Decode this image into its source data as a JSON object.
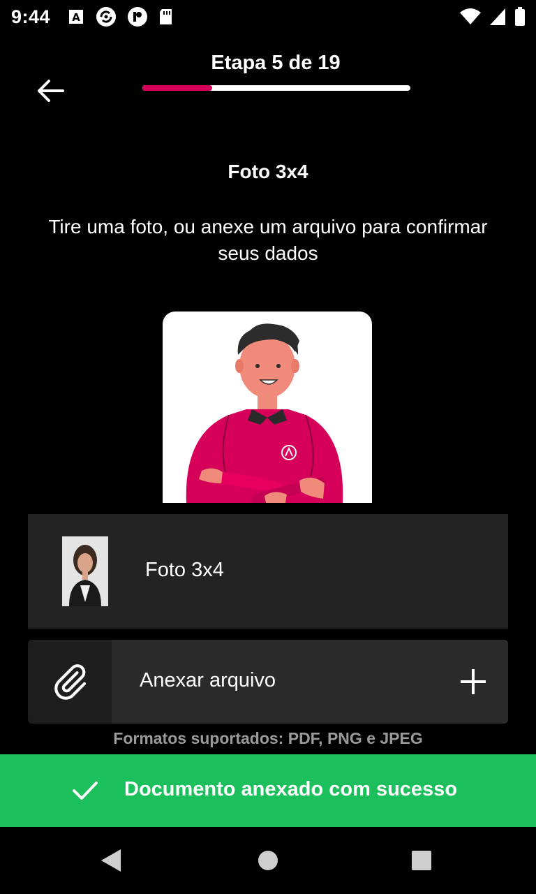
{
  "status_bar": {
    "time": "9:44",
    "icons": [
      "font-a-icon",
      "sync-circle-icon",
      "app-p-icon",
      "sd-card-icon"
    ],
    "right_icons": [
      "wifi-icon",
      "signal-icon",
      "battery-icon"
    ]
  },
  "header": {
    "step_label": "Etapa 5 de 19",
    "progress_fraction": 0.26,
    "accent_color": "#d6005a"
  },
  "content": {
    "heading": "Foto 3x4",
    "description": "Tire uma foto, ou anexe um arquivo para confirmar seus dados"
  },
  "attached_file": {
    "name": "Foto 3x4"
  },
  "attach": {
    "label": "Anexar arquivo",
    "formats_note": "Formatos suportados: PDF, PNG e JPEG"
  },
  "toast": {
    "message": "Documento anexado com sucesso",
    "color": "#1bbf5b"
  },
  "nav": {
    "buttons": [
      "back-triangle-icon",
      "home-circle-icon",
      "recents-square-icon"
    ]
  }
}
